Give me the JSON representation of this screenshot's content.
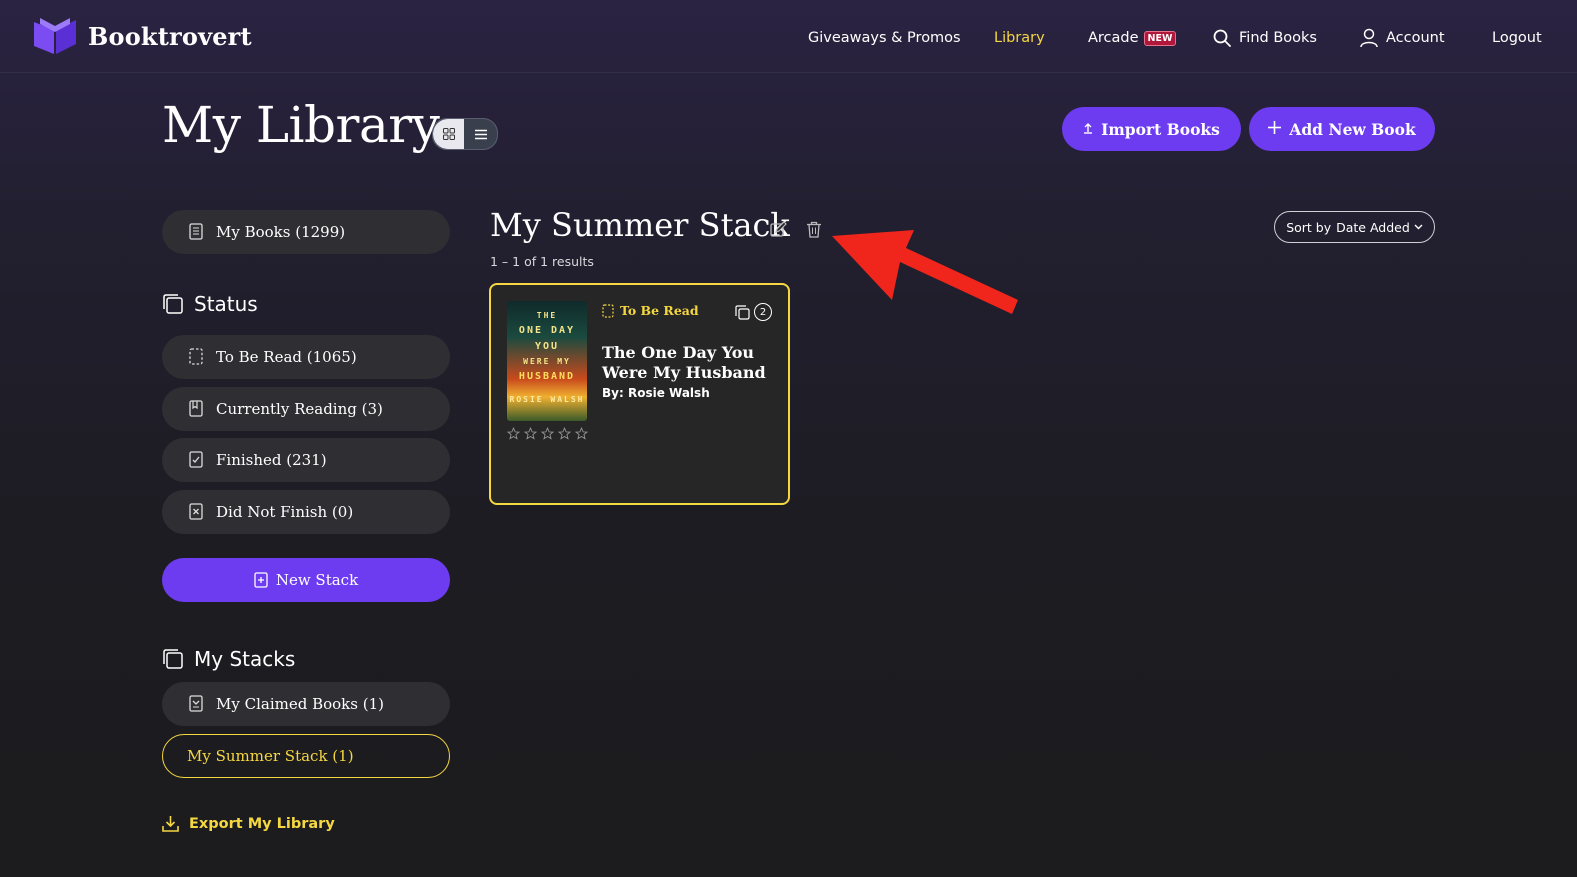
{
  "nav": {
    "brand": "Booktrovert",
    "giveaways": "Giveaways & Promos",
    "library": "Library",
    "arcade": "Arcade",
    "arcade_badge": "NEW",
    "find_books": "Find Books",
    "account": "Account",
    "logout": "Logout"
  },
  "header": {
    "title": "My Library",
    "import_label": "Import Books",
    "add_label": "Add New Book",
    "import_icon": "upload-icon",
    "add_icon": "plus-icon"
  },
  "sidebar": {
    "my_books": "My Books (1299)",
    "status_heading": "Status",
    "status_items": [
      {
        "label": "To Be Read (1065)",
        "icon": "dashed-book-icon"
      },
      {
        "label": "Currently Reading (3)",
        "icon": "bookmark-book-icon"
      },
      {
        "label": "Finished (231)",
        "icon": "check-book-icon"
      },
      {
        "label": "Did Not Finish (0)",
        "icon": "x-book-icon"
      }
    ],
    "new_stack": "New Stack",
    "stacks_heading": "My Stacks",
    "stacks": [
      {
        "label": "My Claimed Books (1)",
        "active": false
      },
      {
        "label": "My Summer Stack (1)",
        "active": true
      }
    ],
    "export": "Export My Library"
  },
  "main": {
    "stack_title": "My Summer Stack",
    "results": "1 – 1 of 1 results",
    "sort_prefix": "Sort by",
    "sort_value": "Date Added"
  },
  "books": [
    {
      "status": "To Be Read",
      "stack_count": "2",
      "title": "The One Day You Were My Husband",
      "author_prefix": "By:",
      "author": "Rosie Walsh",
      "rating": 0,
      "cover_lines": [
        "THE",
        "ONE DAY",
        "YOU",
        "WERE MY",
        "HUSBAND",
        "ROSIE WALSH"
      ]
    }
  ],
  "colors": {
    "accent": "#6d3cf0",
    "highlight": "#f5d742",
    "annotation_arrow": "#f0261c"
  }
}
